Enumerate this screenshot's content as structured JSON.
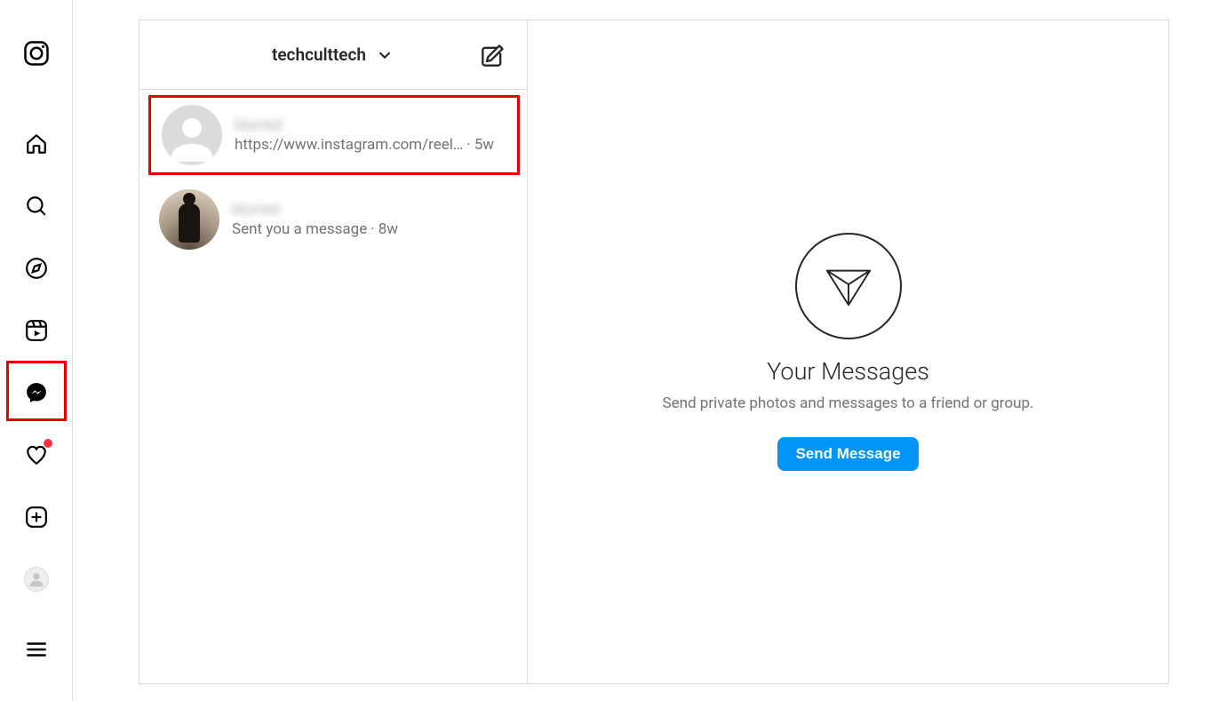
{
  "account": {
    "username": "techculttech"
  },
  "threads": [
    {
      "name": "blurred",
      "preview": "https://www.instagram.com/reel…",
      "time": "5w",
      "highlighted": true,
      "avatar": "placeholder"
    },
    {
      "name": "blurred",
      "preview": "Sent you a message",
      "time": "8w",
      "highlighted": false,
      "avatar": "silhouette"
    }
  ],
  "empty": {
    "title": "Your Messages",
    "desc": "Send private photos and messages to a friend or group.",
    "button": "Send Message"
  }
}
